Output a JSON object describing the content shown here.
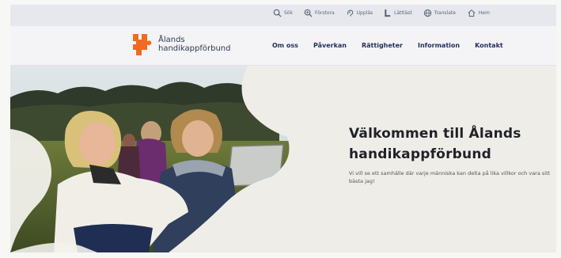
{
  "util_nav": [
    {
      "label": "Sök",
      "icon": "search-icon"
    },
    {
      "label": "Förstora",
      "icon": "zoom-in-icon"
    },
    {
      "label": "Uppläs",
      "icon": "listen-icon"
    },
    {
      "label": "Lättläst",
      "icon": "easy-read-icon"
    },
    {
      "label": "Translate",
      "icon": "globe-icon"
    },
    {
      "label": "Hem",
      "icon": "home-icon"
    }
  ],
  "logo": {
    "line1": "Ålands",
    "line2": "handikappförbund",
    "color": "#f26a21"
  },
  "main_nav": [
    "Om oss",
    "Påverkan",
    "Rättigheter",
    "Information",
    "Kontakt"
  ],
  "hero": {
    "title_line1": "Välkommen till Ålands",
    "title_line2": "handikappförbund",
    "text": "Vi vill se ett samhälle där varje människa kan delta på lika villkor och vara sitt bästa jag!"
  },
  "colors": {
    "brand_orange": "#f26a21",
    "nav_text": "#23315a",
    "title_text": "#1f2226"
  }
}
